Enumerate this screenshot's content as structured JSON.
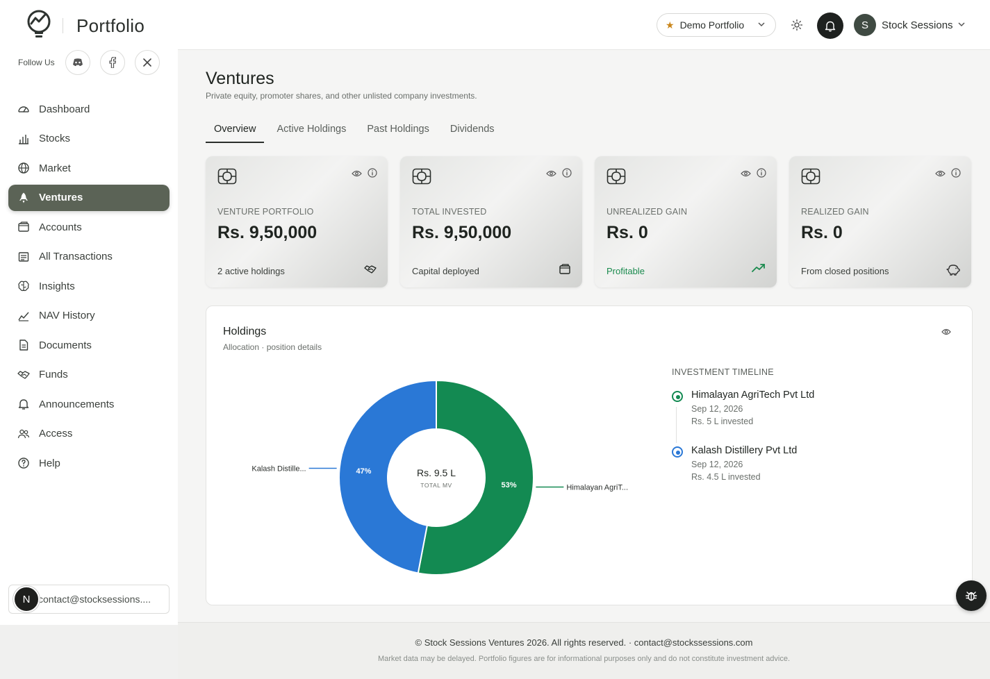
{
  "app": {
    "title": "Portfolio"
  },
  "follow": {
    "label": "Follow Us",
    "icons": [
      "discord-icon",
      "facebook-icon",
      "x-icon"
    ]
  },
  "sidebar": {
    "items": [
      {
        "label": "Dashboard",
        "icon": "dashboard-icon",
        "active": false
      },
      {
        "label": "Stocks",
        "icon": "bar-chart-icon",
        "active": false
      },
      {
        "label": "Market",
        "icon": "globe-icon",
        "active": false
      },
      {
        "label": "Ventures",
        "icon": "rocket-icon",
        "active": true
      },
      {
        "label": "Accounts",
        "icon": "wallet-icon",
        "active": false
      },
      {
        "label": "All Transactions",
        "icon": "receipt-icon",
        "active": false
      },
      {
        "label": "Insights",
        "icon": "brain-icon",
        "active": false
      },
      {
        "label": "NAV History",
        "icon": "line-chart-icon",
        "active": false
      },
      {
        "label": "Documents",
        "icon": "document-icon",
        "active": false
      },
      {
        "label": "Funds",
        "icon": "handshake-icon",
        "active": false
      },
      {
        "label": "Announcements",
        "icon": "bell-icon",
        "active": false
      },
      {
        "label": "Access",
        "icon": "users-icon",
        "active": false
      },
      {
        "label": "Help",
        "icon": "help-icon",
        "active": false
      }
    ],
    "email": "contact@stocksessions....",
    "badge": "N"
  },
  "topbar": {
    "portfolio": "Demo Portfolio",
    "user_initial": "S",
    "user_name": "Stock Sessions"
  },
  "page": {
    "title": "Ventures",
    "subtitle": "Private equity, promoter shares, and other unlisted company investments.",
    "tabs": [
      "Overview",
      "Active Holdings",
      "Past Holdings",
      "Dividends"
    ],
    "active_tab": "Overview"
  },
  "cards": [
    {
      "label": "VENTURE PORTFOLIO",
      "value": "Rs. 9,50,000",
      "foot": "2 active holdings",
      "foot_icon": "handshake-icon"
    },
    {
      "label": "TOTAL INVESTED",
      "value": "Rs. 9,50,000",
      "foot": "Capital deployed",
      "foot_icon": "wallet-icon"
    },
    {
      "label": "UNREALIZED GAIN",
      "value": "Rs. 0",
      "foot": "Profitable",
      "foot_icon": "trending-up-icon",
      "foot_color": "#1a8a4e"
    },
    {
      "label": "REALIZED GAIN",
      "value": "Rs. 0",
      "foot": "From closed positions",
      "foot_icon": "piggy-bank-icon"
    }
  ],
  "holdings": {
    "title": "Holdings",
    "subtitle": "Allocation · position details",
    "center_value": "Rs. 9.5 L",
    "center_label": "TOTAL MV"
  },
  "chart_data": {
    "type": "pie",
    "donut": true,
    "slices": [
      {
        "label": "Himalayan AgriT...",
        "value": 53,
        "display": "53%",
        "color": "#138a52"
      },
      {
        "label": "Kalash Distille...",
        "value": 47,
        "display": "47%",
        "color": "#2a78d6"
      }
    ]
  },
  "timeline": {
    "heading": "INVESTMENT TIMELINE",
    "items": [
      {
        "name": "Himalayan AgriTech Pvt Ltd",
        "date": "Sep 12, 2026",
        "invested": "Rs. 5 L invested",
        "color": "#138a52"
      },
      {
        "name": "Kalash Distillery Pvt Ltd",
        "date": "Sep 12, 2026",
        "invested": "Rs. 4.5 L invested",
        "color": "#2a78d6"
      }
    ]
  },
  "footer": {
    "main": "© Stock Sessions Ventures 2026. All rights reserved. · contact@stockssessions.com",
    "note": "Market data may be delayed. Portfolio figures are for informational purposes only and do not constitute investment advice."
  }
}
